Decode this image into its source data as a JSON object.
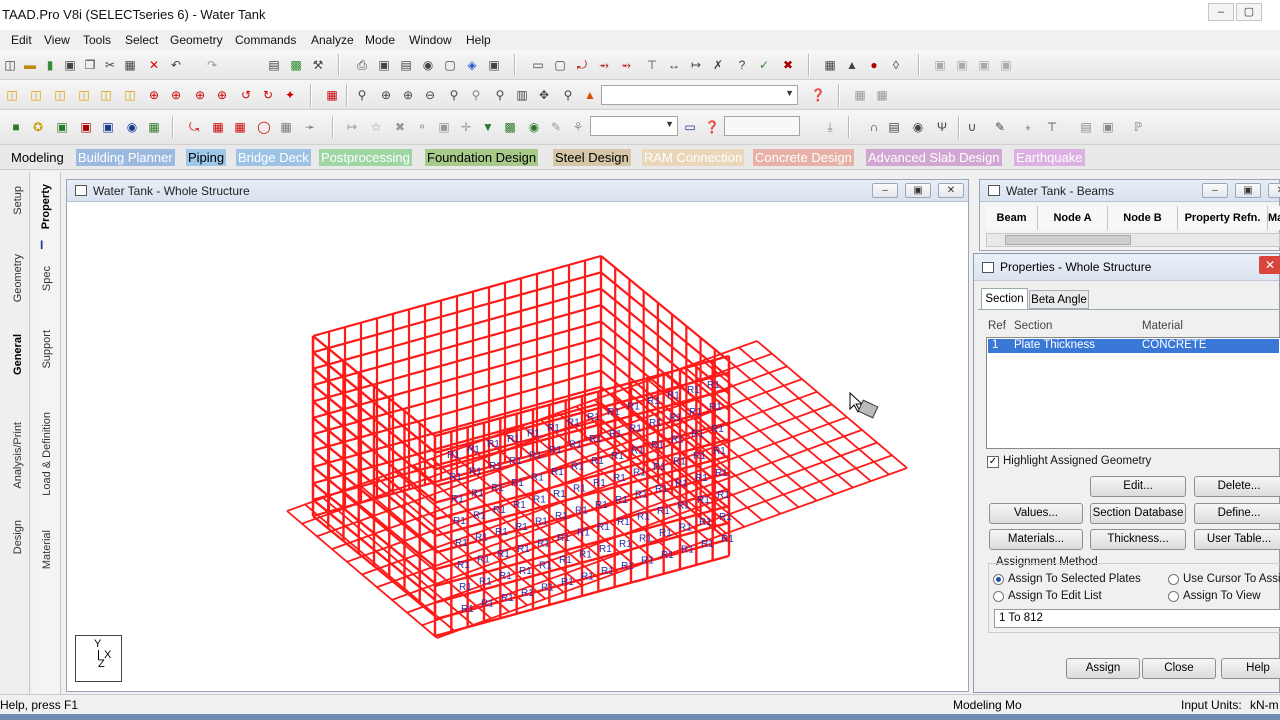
{
  "window": {
    "title": "TAAD.Pro V8i (SELECTseries 6) - Water Tank"
  },
  "menu": [
    "Edit",
    "View",
    "Tools",
    "Select",
    "Geometry",
    "Commands",
    "Analyze",
    "Mode",
    "Window",
    "Help"
  ],
  "page_tabs": [
    {
      "label": "Modeling",
      "active": true
    },
    {
      "label": "Building Planner"
    },
    {
      "label": "Piping"
    },
    {
      "label": "Bridge Deck"
    },
    {
      "label": "Postprocessing"
    },
    {
      "label": "Foundation Design"
    },
    {
      "label": "Steel Design"
    },
    {
      "label": "RAM Connection"
    },
    {
      "label": "Concrete Design"
    },
    {
      "label": "Advanced Slab Design"
    },
    {
      "label": "Earthquake"
    }
  ],
  "left_rail": {
    "outer": [
      "Setup",
      "Geometry",
      "General",
      "Analysis/Print",
      "Design"
    ],
    "inner": [
      "Property",
      "Spec",
      "Support",
      "Load & Definition",
      "Material"
    ]
  },
  "viewport": {
    "title": "Water Tank - Whole Structure",
    "axis_labels": {
      "y": "Y",
      "x": "X",
      "z": "Z"
    }
  },
  "beams_table": {
    "title": "Water Tank - Beams",
    "columns": [
      "Beam",
      "Node A",
      "Node B",
      "Property Refn.",
      "Ma"
    ]
  },
  "properties": {
    "title": "Properties - Whole Structure",
    "tabs": [
      "Section",
      "Beta Angle"
    ],
    "headers": {
      "ref": "Ref",
      "section": "Section",
      "material": "Material"
    },
    "rows": [
      {
        "ref": "1",
        "section": "Plate Thickness",
        "material": "CONCRETE"
      }
    ],
    "highlight_label": "Highlight Assigned Geometry",
    "buttons": {
      "edit": "Edit...",
      "delete": "Delete...",
      "values": "Values...",
      "section_database": "Section Database",
      "define": "Define...",
      "materials": "Materials...",
      "thickness": "Thickness...",
      "user_table": "User Table...",
      "assign": "Assign",
      "close": "Close",
      "help": "Help"
    },
    "assignment": {
      "label": "Assignment Method",
      "opt_selected_plates": "Assign To Selected Plates",
      "opt_cursor": "Use Cursor To Assign",
      "opt_edit_list": "Assign To Edit List",
      "opt_view": "Assign To View",
      "edit_list_value": "1 To 812"
    }
  },
  "status": {
    "help": "Help, press F1",
    "mode": "Modeling Mo",
    "units_label": "Input Units:",
    "units_value": "kN-m"
  },
  "colors": {
    "structure": "#ff1a1a",
    "labels": "#2a2aa8",
    "selection": "#3a78d8"
  }
}
